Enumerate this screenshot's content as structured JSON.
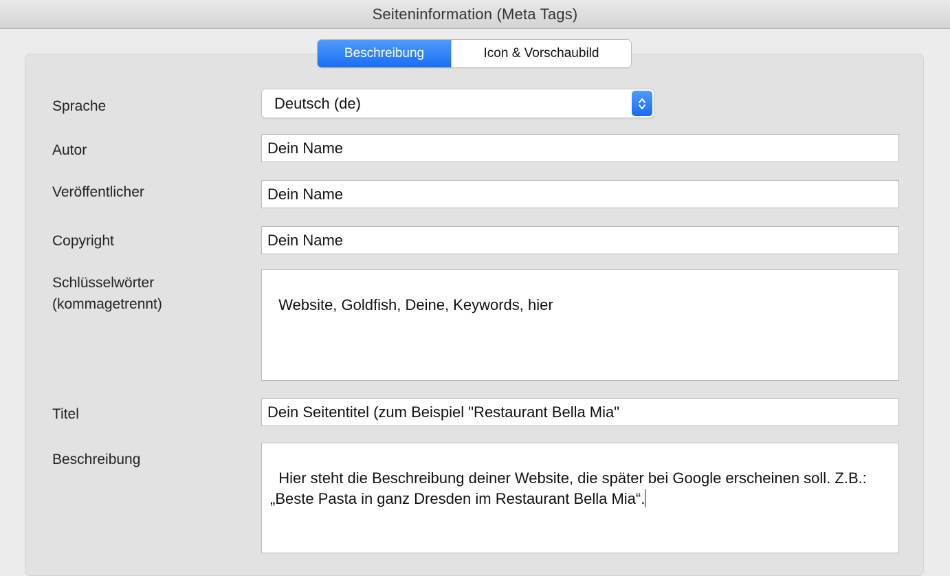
{
  "window": {
    "title": "Seiteninformation (Meta Tags)"
  },
  "tabs": [
    {
      "label": "Beschreibung",
      "active": true
    },
    {
      "label": "Icon & Vorschaubild",
      "active": false
    }
  ],
  "form": {
    "language": {
      "label": "Sprache",
      "value": "Deutsch (de)"
    },
    "author": {
      "label": "Autor",
      "value": "Dein Name"
    },
    "publisher": {
      "label": "Veröffentlicher",
      "value": "Dein Name"
    },
    "copyright": {
      "label": "Copyright",
      "value": "Dein Name"
    },
    "keywords": {
      "label_line1": "Schlüsselwörter",
      "label_line2": "(kommagetrennt)",
      "value": "Website, Goldfish, Deine, Keywords, hier"
    },
    "title": {
      "label": "Titel",
      "value": "Dein Seitentitel (zum Beispiel \"Restaurant Bella Mia\""
    },
    "description": {
      "label": "Beschreibung",
      "value": "Hier steht die Beschreibung deiner Website, die später bei Google erscheinen soll. Z.B.: „Beste Pasta in ganz Dresden im Restaurant Bella Mia“."
    }
  },
  "colors": {
    "accent": "#1b6df5",
    "background": "#ececec",
    "panel": "#e2e2e2"
  },
  "icons": {
    "select_stepper": "chevron-up-down-icon"
  }
}
